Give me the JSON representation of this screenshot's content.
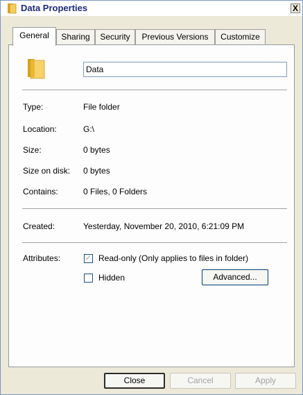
{
  "window": {
    "title": "Data Properties",
    "close_label": "X"
  },
  "tabs": [
    {
      "label": "General",
      "active": true
    },
    {
      "label": "Sharing",
      "active": false
    },
    {
      "label": "Security",
      "active": false
    },
    {
      "label": "Previous Versions",
      "active": false
    },
    {
      "label": "Customize",
      "active": false
    }
  ],
  "general": {
    "folder_name": "Data",
    "fields": [
      {
        "label": "Type:",
        "value": "File folder"
      },
      {
        "label": "Location:",
        "value": "G:\\"
      },
      {
        "label": "Size:",
        "value": "0 bytes"
      },
      {
        "label": "Size on disk:",
        "value": "0 bytes"
      },
      {
        "label": "Contains:",
        "value": "0 Files, 0 Folders"
      }
    ],
    "created": {
      "label": "Created:",
      "value": "Yesterday, November 20, 2010, 6:21:09 PM"
    },
    "attributes": {
      "label": "Attributes:",
      "readonly": {
        "label": "Read-only (Only applies to files in folder)",
        "checked": true,
        "indeterminate": true
      },
      "hidden": {
        "label": "Hidden",
        "checked": false
      },
      "advanced_button": "Advanced..."
    }
  },
  "buttons": {
    "close": "Close",
    "cancel": "Cancel",
    "apply": "Apply"
  },
  "icons": {
    "title_icon": "folder-icon",
    "folder_icon": "folder-icon"
  },
  "colors": {
    "dialog_bg": "#ece9d8",
    "panel_bg": "#fdfdfd",
    "folder_yellow": "#f2c94c"
  }
}
